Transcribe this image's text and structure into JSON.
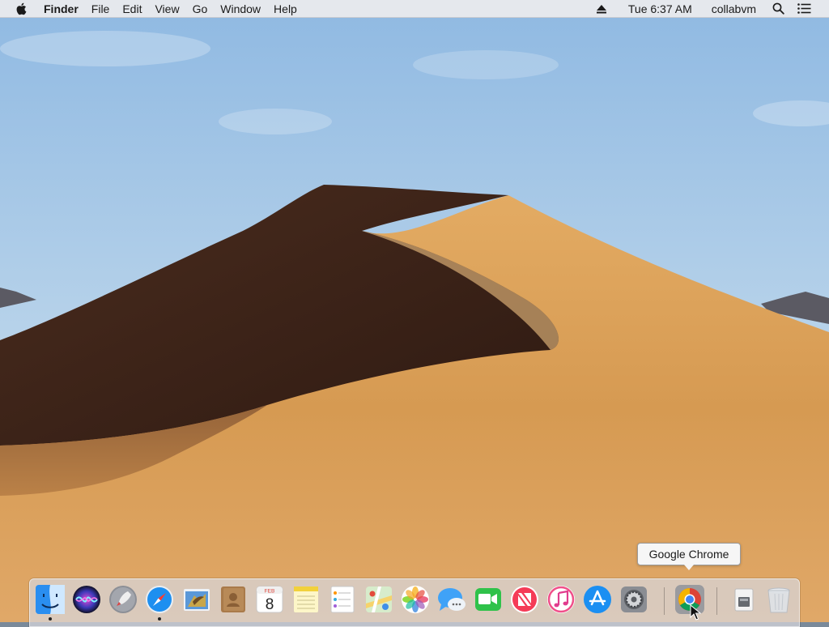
{
  "menubar": {
    "app_name": "Finder",
    "menus": [
      "File",
      "Edit",
      "View",
      "Go",
      "Window",
      "Help"
    ],
    "clock": "Tue 6:37 AM",
    "user": "collabvm"
  },
  "tooltip": {
    "text": "Google Chrome"
  },
  "dock": {
    "apps": [
      {
        "name": "Finder",
        "icon": "finder-icon",
        "running": true
      },
      {
        "name": "Siri",
        "icon": "siri-icon",
        "running": false
      },
      {
        "name": "Launchpad",
        "icon": "launchpad-icon",
        "running": false
      },
      {
        "name": "Safari",
        "icon": "safari-icon",
        "running": true
      },
      {
        "name": "Mail",
        "icon": "mail-icon",
        "running": false
      },
      {
        "name": "Contacts",
        "icon": "contacts-icon",
        "running": false
      },
      {
        "name": "Calendar",
        "icon": "calendar-icon",
        "running": false,
        "month": "FEB",
        "day": "8"
      },
      {
        "name": "Notes",
        "icon": "notes-icon",
        "running": false
      },
      {
        "name": "Reminders",
        "icon": "reminders-icon",
        "running": false
      },
      {
        "name": "Maps",
        "icon": "maps-icon",
        "running": false
      },
      {
        "name": "Photos",
        "icon": "photos-icon",
        "running": false
      },
      {
        "name": "Messages",
        "icon": "messages-icon",
        "running": false
      },
      {
        "name": "FaceTime",
        "icon": "facetime-icon",
        "running": false
      },
      {
        "name": "News",
        "icon": "news-icon",
        "running": false
      },
      {
        "name": "iTunes",
        "icon": "itunes-icon",
        "running": false
      },
      {
        "name": "App Store",
        "icon": "app-store-icon",
        "running": false
      },
      {
        "name": "System Preferences",
        "icon": "system-preferences-icon",
        "running": false
      },
      {
        "name": "Google Chrome",
        "icon": "chrome-icon",
        "running": false,
        "hovered": true
      },
      {
        "name": "Downloads",
        "icon": "downloads-stack-icon",
        "running": false
      },
      {
        "name": "Trash",
        "icon": "trash-icon",
        "running": false
      }
    ]
  },
  "colors": {
    "sky_top": "#9ec3e6",
    "sky_bottom": "#c9dcea",
    "dune_light": "#d9a35a",
    "dune_shadow": "#3b2419"
  }
}
